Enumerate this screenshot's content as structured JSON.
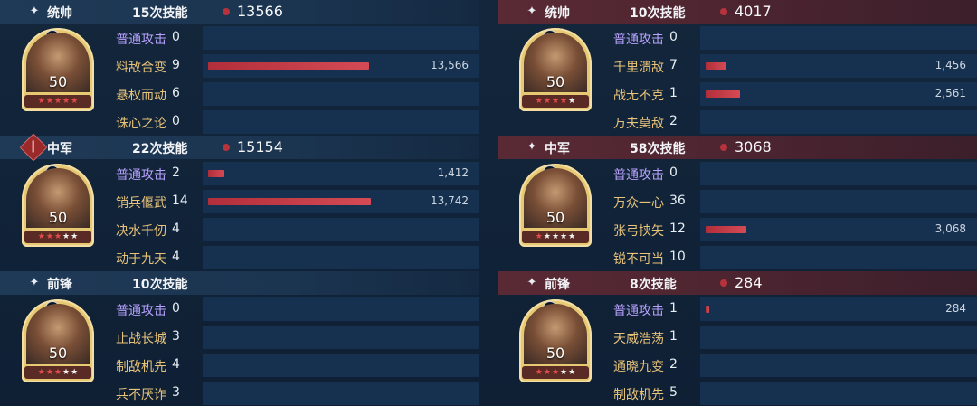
{
  "panels": [
    {
      "side": "left",
      "role": "统帅",
      "role_icon": "star-icon",
      "count": "15次技能",
      "total": "13566",
      "level": "50",
      "stars": [
        "red",
        "red",
        "red",
        "red",
        "red"
      ],
      "rows": [
        {
          "skill": "普通攻击",
          "num": "0",
          "dmg": "",
          "pct": 0,
          "basic": true
        },
        {
          "skill": "料敌合变",
          "num": "9",
          "dmg": "13,566",
          "pct": 0.99
        },
        {
          "skill": "悬权而动",
          "num": "6",
          "dmg": "",
          "pct": 0
        },
        {
          "skill": "诛心之论",
          "num": "0",
          "dmg": "",
          "pct": 0
        }
      ]
    },
    {
      "side": "left",
      "role": "中军",
      "role_icon": "flag-icon",
      "count": "22次技能",
      "total": "15154",
      "level": "50",
      "stars": [
        "red",
        "red",
        "red",
        "white",
        "white"
      ],
      "rows": [
        {
          "skill": "普通攻击",
          "num": "2",
          "dmg": "1,412",
          "pct": 0.1,
          "basic": true
        },
        {
          "skill": "销兵偃武",
          "num": "14",
          "dmg": "13,742",
          "pct": 1.0
        },
        {
          "skill": "决水千仞",
          "num": "4",
          "dmg": "",
          "pct": 0
        },
        {
          "skill": "动于九天",
          "num": "4",
          "dmg": "",
          "pct": 0
        }
      ]
    },
    {
      "side": "left",
      "role": "前锋",
      "role_icon": "star-icon",
      "count": "10次技能",
      "total": "",
      "level": "50",
      "stars": [
        "red",
        "red",
        "red",
        "white",
        "white"
      ],
      "rows": [
        {
          "skill": "普通攻击",
          "num": "0",
          "dmg": "",
          "pct": 0,
          "basic": true
        },
        {
          "skill": "止战长城",
          "num": "3",
          "dmg": "",
          "pct": 0
        },
        {
          "skill": "制敌机先",
          "num": "4",
          "dmg": "",
          "pct": 0
        },
        {
          "skill": "兵不厌诈",
          "num": "3",
          "dmg": "",
          "pct": 0
        }
      ]
    },
    {
      "side": "right",
      "role": "统帅",
      "role_icon": "star-icon",
      "count": "10次技能",
      "total": "4017",
      "level": "50",
      "stars": [
        "red",
        "red",
        "red",
        "red",
        "white"
      ],
      "rows": [
        {
          "skill": "普通攻击",
          "num": "0",
          "dmg": "",
          "pct": 0,
          "basic": true
        },
        {
          "skill": "千里溃敌",
          "num": "7",
          "dmg": "1,456",
          "pct": 0.13
        },
        {
          "skill": "战无不克",
          "num": "1",
          "dmg": "2,561",
          "pct": 0.21
        },
        {
          "skill": "万夫莫敌",
          "num": "2",
          "dmg": "",
          "pct": 0
        }
      ]
    },
    {
      "side": "right",
      "role": "中军",
      "role_icon": "star-icon",
      "count": "58次技能",
      "total": "3068",
      "level": "50",
      "stars": [
        "red",
        "white",
        "white",
        "white",
        "white"
      ],
      "rows": [
        {
          "skill": "普通攻击",
          "num": "0",
          "dmg": "",
          "pct": 0,
          "basic": true
        },
        {
          "skill": "万众一心",
          "num": "36",
          "dmg": "",
          "pct": 0
        },
        {
          "skill": "张弓挟矢",
          "num": "12",
          "dmg": "3,068",
          "pct": 0.25
        },
        {
          "skill": "锐不可当",
          "num": "10",
          "dmg": "",
          "pct": 0
        }
      ]
    },
    {
      "side": "right",
      "role": "前锋",
      "role_icon": "star-icon",
      "count": "8次技能",
      "total": "284",
      "level": "50",
      "stars": [
        "red",
        "red",
        "red",
        "white",
        "white"
      ],
      "rows": [
        {
          "skill": "普通攻击",
          "num": "1",
          "dmg": "284",
          "pct": 0.02,
          "basic": true
        },
        {
          "skill": "天威浩荡",
          "num": "1",
          "dmg": "",
          "pct": 0
        },
        {
          "skill": "通晓九变",
          "num": "2",
          "dmg": "",
          "pct": 0
        },
        {
          "skill": "制敌机先",
          "num": "5",
          "dmg": "",
          "pct": 0
        }
      ]
    }
  ]
}
